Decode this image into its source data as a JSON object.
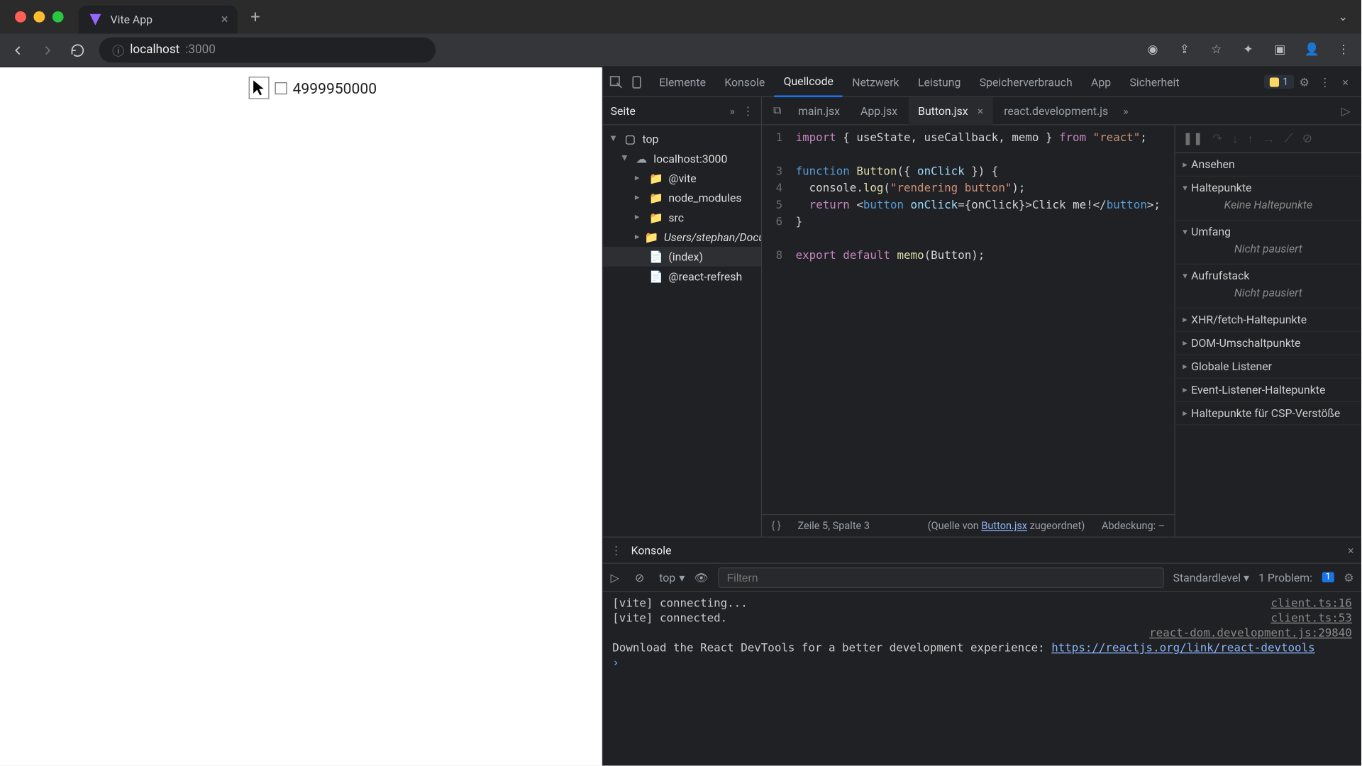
{
  "browser": {
    "tab_title": "Vite App",
    "url_host": "localhost",
    "url_path": ":3000"
  },
  "page": {
    "display_value": "4999950000"
  },
  "devtools": {
    "tabs": [
      "Elemente",
      "Konsole",
      "Quellcode",
      "Netzwerk",
      "Leistung",
      "Speicherverbrauch",
      "App",
      "Sicherheit"
    ],
    "active_tab": "Quellcode",
    "issue_count": "1",
    "sources": {
      "nav_label": "Seite",
      "open_files": [
        "main.jsx",
        "App.jsx",
        "Button.jsx",
        "react.development.js"
      ],
      "active_file": "Button.jsx",
      "tree": {
        "root": "top",
        "host": "localhost:3000",
        "items": [
          "@vite",
          "node_modules",
          "src",
          "Users/stephan/Docum",
          "(index)",
          "@react-refresh"
        ]
      },
      "code": {
        "lines": {
          "1": "import { useState, useCallback, memo } from \"react\";",
          "3": "function Button({ onClick }) {",
          "4": "  console.log(\"rendering button\");",
          "5": "  return <button onClick={onClick}>Click me!</button>;",
          "6": "}",
          "8": "export default memo(Button);"
        }
      },
      "status": {
        "pos": "Zeile 5, Spalte 3",
        "map_prefix": "(Quelle von ",
        "map_file": "Button.jsx",
        "map_suffix": " zugeordnet)",
        "coverage": "Abdeckung: –"
      }
    },
    "debugger": {
      "sections": {
        "watch": "Ansehen",
        "breakpoints": "Haltepunkte",
        "breakpoints_empty": "Keine Haltepunkte",
        "scope": "Umfang",
        "scope_empty": "Nicht pausiert",
        "callstack": "Aufrufstack",
        "callstack_empty": "Nicht pausiert",
        "xhr": "XHR/fetch-Haltepunkte",
        "dom": "DOM-Umschaltpunkte",
        "global": "Globale Listener",
        "event": "Event-Listener-Haltepunkte",
        "csp": "Haltepunkte für CSP-Verstöße"
      }
    }
  },
  "console": {
    "drawer_label": "Konsole",
    "context": "top",
    "filter_placeholder": "Filtern",
    "level": "Standardlevel",
    "problems_label": "1 Problem:",
    "problems_count": "1",
    "logs": [
      {
        "msg": "[vite] connecting...",
        "src": "client.ts:16"
      },
      {
        "msg": "[vite] connected.",
        "src": "client.ts:53"
      },
      {
        "msg": "",
        "src": "react-dom.development.js:29840",
        "right": true
      },
      {
        "msg": "Download the React DevTools for a better development experience: ",
        "link": "https://reactjs.org/link/react-devtools"
      }
    ]
  }
}
